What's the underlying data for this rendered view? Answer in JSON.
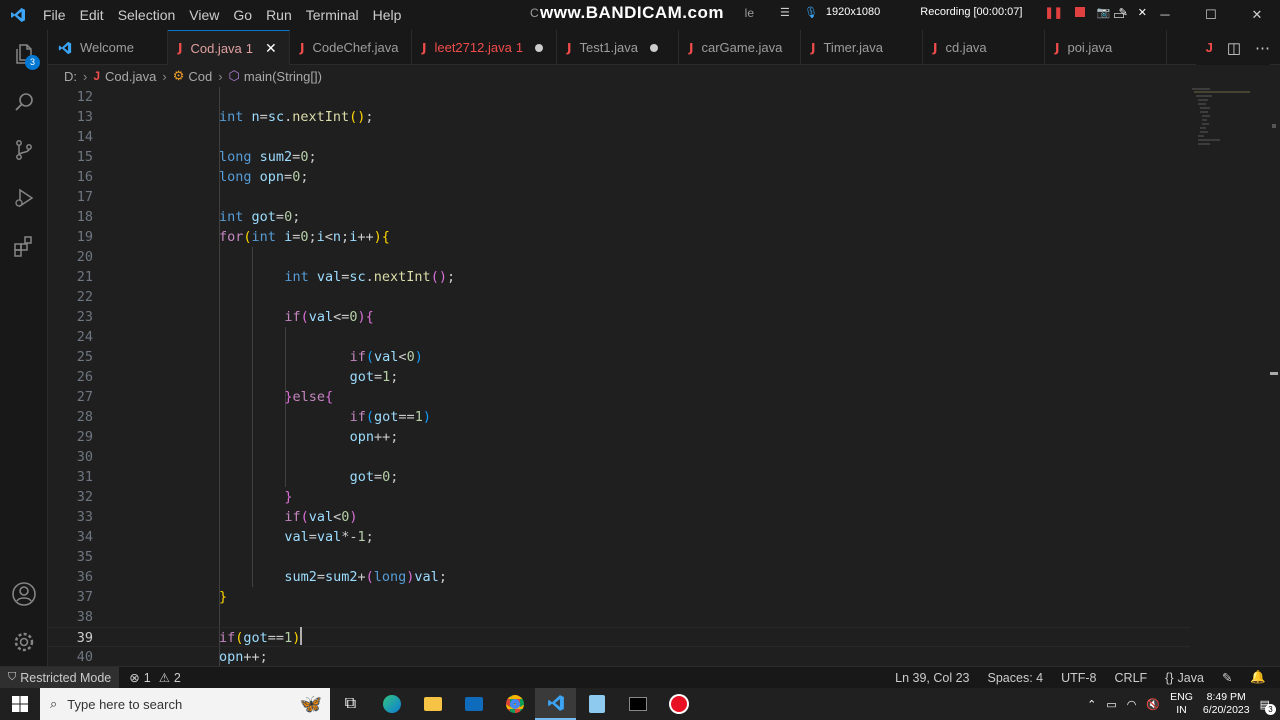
{
  "menu": [
    "File",
    "Edit",
    "Selection",
    "View",
    "Go",
    "Run",
    "Terminal",
    "Help"
  ],
  "title_text": "C",
  "title_suffix": "le",
  "watermark": "www.BANDICAM.com",
  "recorder": {
    "resolution": "1920x1080",
    "status": "Recording [00:00:07]"
  },
  "activity_badge": "3",
  "tabs": [
    {
      "label": "Welcome",
      "type": "vscode",
      "state": "normal"
    },
    {
      "label": "Cod.java",
      "count": "1",
      "type": "java",
      "state": "active"
    },
    {
      "label": "CodeChef.java",
      "type": "java",
      "state": "normal"
    },
    {
      "label": "leet2712.java",
      "count": "1",
      "type": "java",
      "state": "modified"
    },
    {
      "label": "Test1.java",
      "type": "java",
      "state": "dirty"
    },
    {
      "label": "carGame.java",
      "type": "java",
      "state": "normal"
    },
    {
      "label": "Timer.java",
      "type": "java",
      "state": "normal"
    },
    {
      "label": "cd.java",
      "type": "java",
      "state": "normal"
    },
    {
      "label": "poi.java",
      "type": "java",
      "state": "normal"
    }
  ],
  "breadcrumb": {
    "drive": "D:",
    "file": "Cod.java",
    "class": "Cod",
    "method": "main(String[])"
  },
  "code": [
    {
      "n": "12",
      "html": ""
    },
    {
      "n": "13",
      "html": "        <span class='k'>int</span> <span class='v'>n</span>=<span class='v'>sc</span>.<span class='f'>nextInt</span><span class='p1'>()</span>;"
    },
    {
      "n": "14",
      "html": ""
    },
    {
      "n": "15",
      "html": "        <span class='k'>long</span> <span class='v'>sum2</span>=<span class='n'>0</span>;"
    },
    {
      "n": "16",
      "html": "        <span class='k'>long</span> <span class='v'>opn</span>=<span class='n'>0</span>;"
    },
    {
      "n": "17",
      "html": ""
    },
    {
      "n": "18",
      "html": "        <span class='k'>int</span> <span class='v'>got</span>=<span class='n'>0</span>;"
    },
    {
      "n": "19",
      "html": "        <span class='ctl'>for</span><span class='p1'>(</span><span class='k'>int</span> <span class='v'>i</span>=<span class='n'>0</span>;<span class='v'>i</span>&lt;<span class='v'>n</span>;<span class='v'>i</span>++<span class='p1'>)</span><span class='p1'>{</span>"
    },
    {
      "n": "20",
      "html": ""
    },
    {
      "n": "21",
      "html": "            <span class='k'>int</span> <span class='v'>val</span>=<span class='v'>sc</span>.<span class='f'>nextInt</span><span class='p2'>()</span>;"
    },
    {
      "n": "22",
      "html": ""
    },
    {
      "n": "23",
      "html": "            <span class='ctl'>if</span><span class='p2'>(</span><span class='v'>val</span>&lt;=<span class='n'>0</span><span class='p2'>)</span><span class='p2'>{</span>"
    },
    {
      "n": "24",
      "html": ""
    },
    {
      "n": "25",
      "html": "                <span class='ctl'>if</span><span class='p3'>(</span><span class='v'>val</span>&lt;<span class='n'>0</span><span class='p3'>)</span>"
    },
    {
      "n": "26",
      "html": "                <span class='v'>got</span>=<span class='n'>1</span>;"
    },
    {
      "n": "27",
      "html": "            <span class='p2'>}</span><span class='ctl'>else</span><span class='p2'>{</span>"
    },
    {
      "n": "28",
      "html": "                <span class='ctl'>if</span><span class='p3'>(</span><span class='v'>got</span>==<span class='n'>1</span><span class='p3'>)</span>"
    },
    {
      "n": "29",
      "html": "                <span class='v'>opn</span>++;"
    },
    {
      "n": "30",
      "html": ""
    },
    {
      "n": "31",
      "html": "                <span class='v'>got</span>=<span class='n'>0</span>;"
    },
    {
      "n": "32",
      "html": "            <span class='p2'>}</span>"
    },
    {
      "n": "33",
      "html": "            <span class='ctl'>if</span><span class='p2'>(</span><span class='v'>val</span>&lt;<span class='n'>0</span><span class='p2'>)</span>"
    },
    {
      "n": "34",
      "html": "            <span class='v'>val</span>=<span class='v'>val</span>*-<span class='n'>1</span>;"
    },
    {
      "n": "35",
      "html": ""
    },
    {
      "n": "36",
      "html": "            <span class='v'>sum2</span>=<span class='v'>sum2</span>+<span class='p2'>(</span><span class='k'>long</span><span class='p2'>)</span><span class='v'>val</span>;"
    },
    {
      "n": "37",
      "html": "        <span class='p1'>}</span>"
    },
    {
      "n": "38",
      "html": ""
    },
    {
      "n": "39",
      "html": "        <span class='ctl'>if</span><span class='p1'>(</span><span class='v'>got</span>==<span class='n'>1</span><span class='p1'>)</span>"
    },
    {
      "n": "40",
      "html": "        <span class='v'>opn</span>++;"
    }
  ],
  "current_line": "39",
  "status": {
    "mode": "Restricted Mode",
    "errors": "1",
    "warnings": "2",
    "position": "Ln 39, Col 23",
    "spaces": "Spaces: 4",
    "encoding": "UTF-8",
    "eol": "CRLF",
    "language": "Java"
  },
  "taskbar": {
    "search_placeholder": "Type here to search",
    "lang": "ENG",
    "region": "IN",
    "time": "8:49 PM",
    "date": "6/20/2023",
    "notification_count": "3"
  }
}
